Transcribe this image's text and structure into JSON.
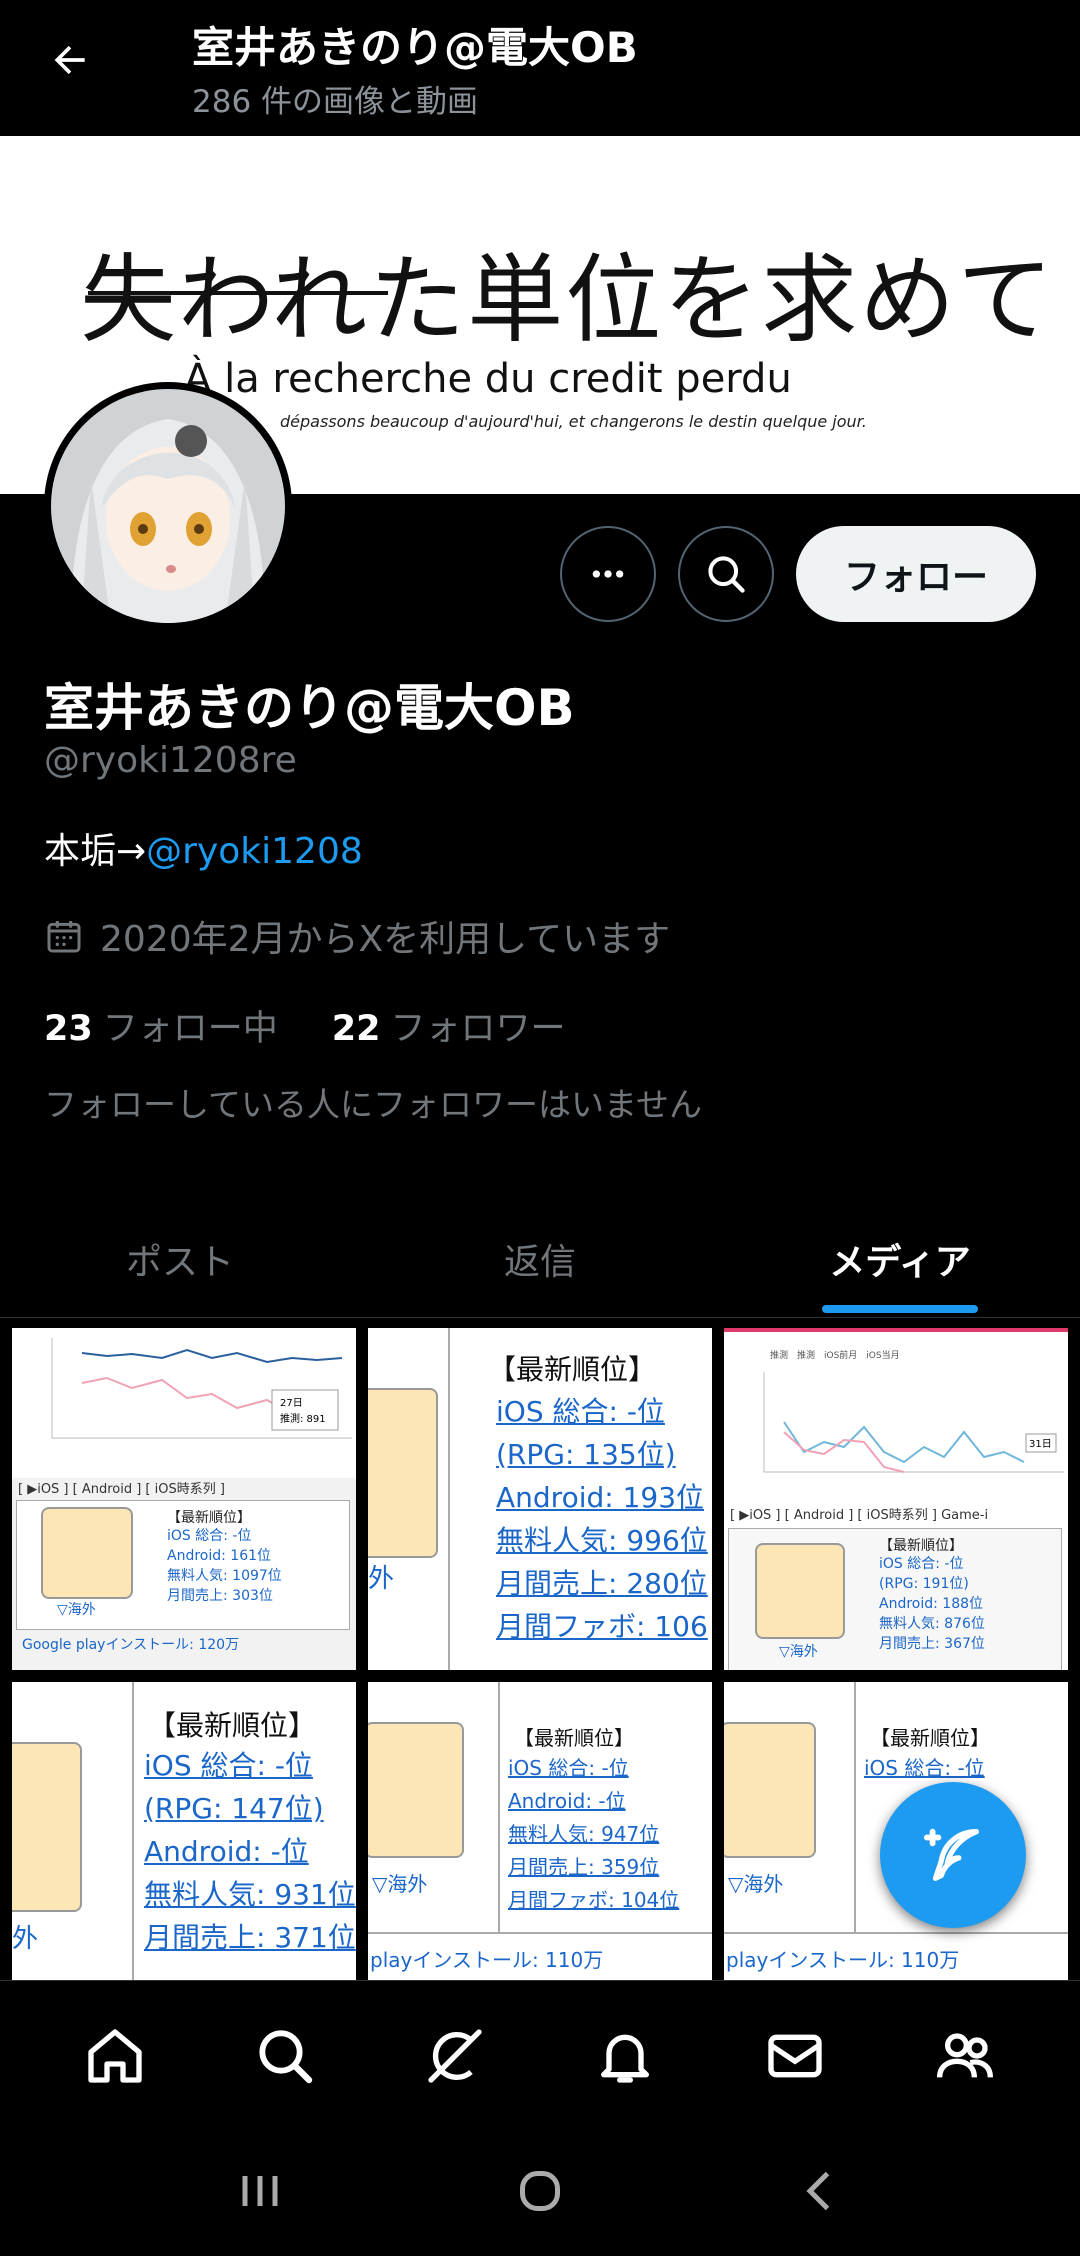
{
  "header": {
    "title": "室井あきのり@電大OB",
    "subtitle": "286 件の画像と動画"
  },
  "banner": {
    "title": "失われた単位を求めて",
    "subtitle": "À la recherche du credit perdu",
    "small": "dépassons beaucoup d'aujourd'hui, et changerons le destin quelque jour."
  },
  "actions": {
    "follow_label": "フォロー"
  },
  "profile": {
    "display_name": "室井あきのり@電大OB",
    "handle": "@ryoki1208re",
    "bio_text": "本垢→",
    "bio_link": "@ryoki1208",
    "joined": "2020年2月からXを利用しています",
    "following_count": "23",
    "following_label": "フォロー中",
    "followers_count": "22",
    "followers_label": "フォロワー",
    "mutuals_note": "フォローしている人にフォロワーはいません"
  },
  "tabs": [
    {
      "label": "ポスト"
    },
    {
      "label": "返信"
    },
    {
      "label": "メディア"
    }
  ],
  "media": {
    "t1": {
      "callout_day": "27日",
      "callout_value": "推測: 891",
      "links": "[ ▶iOS ] [ Android ] [ iOS時系列 ]",
      "head": "【最新順位】",
      "lines": [
        "iOS 総合: -位",
        "Android: 161位",
        "無料人気: 1097位",
        "月間売上: 303位"
      ],
      "caption": "▽海外",
      "footer": "Google playインストール: 120万"
    },
    "t2": {
      "head": "【最新順位】",
      "lines": [
        "iOS 総合: -位",
        "(RPG: 135位)",
        "Android: 193位",
        "無料人気: 996位",
        "月間売上: 280位",
        "月間ファボ: 106"
      ],
      "caption": "外"
    },
    "t3": {
      "legend": "推測　推測　iOS前月　iOS当月",
      "callout": "31日",
      "links": "[ ▶iOS ] [ Android ] [ iOS時系列 ] Game-i",
      "head": "【最新順位】",
      "lines": [
        "iOS 総合: -位",
        "(RPG: 191位)",
        "Android: 188位",
        "無料人気: 876位",
        "月間売上: 367位"
      ],
      "caption": "▽海外"
    },
    "t4": {
      "head": "【最新順位】",
      "lines": [
        "iOS 総合: -位",
        "(RPG: 147位)",
        "Android: -位",
        "無料人気: 931位",
        "月間売上: 371位"
      ],
      "caption": "外"
    },
    "t5": {
      "head": "【最新順位】",
      "lines": [
        "iOS 総合: -位",
        "Android: -位",
        "無料人気: 947位",
        "月間売上: 359位",
        "月間ファボ: 104位"
      ],
      "caption": "▽海外",
      "footer": "playインストール: 110万"
    },
    "t6": {
      "head": "【最新順位】",
      "lines": [
        "iOS 総合: -位"
      ],
      "caption": "▽海外",
      "footer": "playインストール: 110万"
    }
  },
  "icons": {
    "back": "arrow-left-icon",
    "more": "ellipsis-icon",
    "search": "search-icon",
    "calendar": "calendar-icon",
    "compose": "compose-icon"
  },
  "colors": {
    "accent": "#1d9bf0",
    "background": "#000000",
    "muted": "#71767b"
  }
}
